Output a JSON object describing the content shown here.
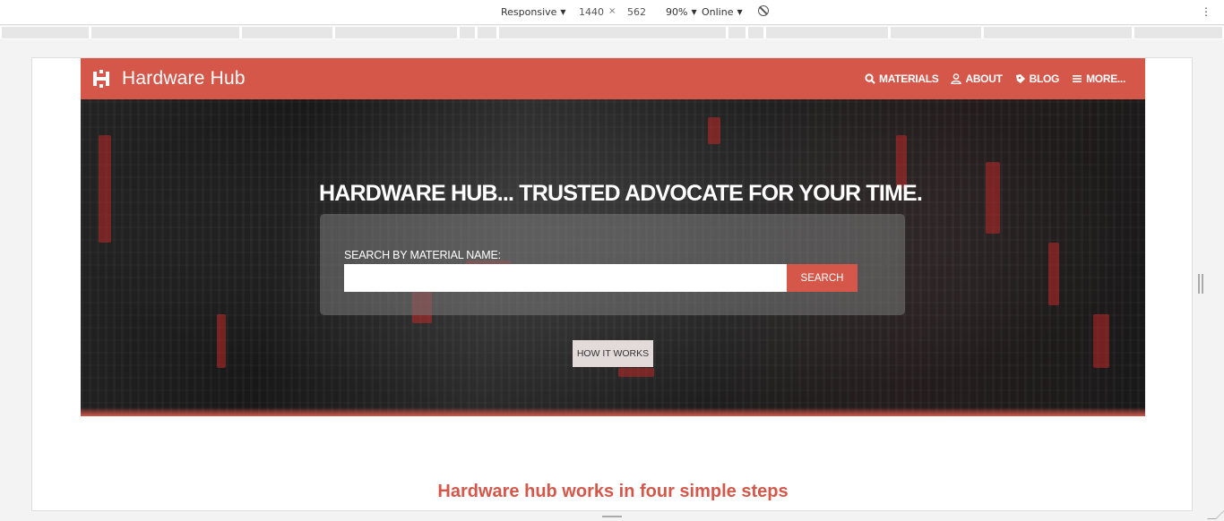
{
  "devtools": {
    "device": "Responsive",
    "width": "1440",
    "times": "×",
    "height": "562",
    "zoom": "90%",
    "network": "Online",
    "caret": "▼",
    "more": "⋮"
  },
  "site": {
    "brand": "Hardware Hub",
    "nav": [
      {
        "label": "MATERIALS",
        "icon": "search-icon"
      },
      {
        "label": "ABOUT",
        "icon": "user-icon"
      },
      {
        "label": "BLOG",
        "icon": "blog-icon"
      },
      {
        "label": "MORE...",
        "icon": "menu-icon"
      }
    ],
    "colors": {
      "accent": "#d4574a",
      "button_light": "#e3dada"
    }
  },
  "hero": {
    "title": "HARDWARE  HUB... TRUSTED ADVOCATE  FOR YOUR TIME.",
    "search_label": "SEARCH  BY  MATERIAL  NAME:",
    "search_value": "",
    "search_button": "SEARCH",
    "how_button": "HOW  IT WORKS"
  },
  "steps": {
    "heading": "Hardware hub works in four simple steps"
  }
}
